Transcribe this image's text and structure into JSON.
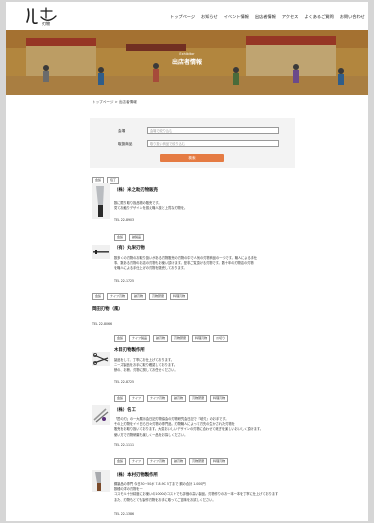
{
  "logo_text": "刃物",
  "nav": [
    "トップページ",
    "お知らせ",
    "イベント情報",
    "出店者情報",
    "アクセス",
    "よくあるご質問",
    "お問い合わせ"
  ],
  "hero": {
    "subtitle": "Exhibitor",
    "title": "出店者情報"
  },
  "breadcrumb": "トップページ > 出店者情報",
  "search": {
    "keyword_label": "会場",
    "keyword_placeholder": "会場で絞り込む",
    "category_label": "取扱商品",
    "category_placeholder": "取り扱い商品で絞り込む",
    "button": "検索"
  },
  "stores": [
    {
      "tags": [
        "会館",
        "包丁"
      ],
      "name": "（株）米之助刃物販売",
      "desc": [
        "数に限り取り扱品物の販売です。",
        "見てお触りデザインを揃え職人技と上質な刃物を。"
      ],
      "tel": "TEL 22-8903"
    },
    {
      "tags": [
        "会館",
        "鋏製品"
      ],
      "name": "（有）丸栄刃物",
      "desc": [
        "数多くの刃物のお取り扱いがある刃物販売の刃物の中で人気の刃物商品の一つです。職人による手仕",
        "事、数ある刃物のお店の刃物もお使い頂けます。是非ご覧頂ける刃物です。数十年の刃物店の刃物",
        "を職人による手仕上げの刃物を販売しております。"
      ],
      "tel": "TEL 22-1725"
    },
    {
      "tags": [
        "会館",
        "ナイフ刃物",
        "鋏刃物",
        "刃物研磨",
        "料理刃物"
      ],
      "name": "岡田刃物（風）",
      "desc": [],
      "tel": "TEL 22-8066"
    },
    {
      "tags": [
        "会館",
        "ナイフ製品",
        "鋏刃物",
        "刃物研磨",
        "料理刃物",
        "爪切り"
      ],
      "name": "木目刃物製作所",
      "desc": [
        "製品をして、丁寧にお仕上げております。",
        "ニーズ製品をお手に取り確認しております。",
        "鋏の、お鋏、刃物に関してお任せください。"
      ],
      "tel": "TEL 22-8725"
    },
    {
      "tags": [
        "会館",
        "ナイフ",
        "ナイフ刃物",
        "鋏刃物",
        "刃物研磨",
        "料理刃物"
      ],
      "name": "（株）名工",
      "desc": [
        "「匠の刃」の一大展示会日記刃物協会の刃物研究会日記で『岐刃』のお手です。",
        "その上刃物をイイ日ら日々刃物の専門品。刃物職人によって刃先の生かされた刃物を",
        "販売をお取り扱いております。大変おいしいデザインの刃物に合わせて砥ぎを楽しいおいしく頂けます。",
        "使い方で刃物研磨も楽しく一品をお探しください。"
      ],
      "tel": "TEL 22-1111"
    },
    {
      "tags": [
        "会館",
        "ナイフ",
        "ナイフ刃物",
        "鋏刃物",
        "刃物研磨",
        "料理刃物"
      ],
      "name": "（株）本村刃物製作所",
      "desc": [
        "鋼製品の専門 今日30−50ポ 7.8.9C 5丁まで 鋼の合計 1.000円",
        "数種の洋の刃物を一",
        "コスモル十分精度にお使いの1000のコストでも評価の高い製品。刃物作りのお一本一本を丁寧に仕上げております",
        "また、刃物もとても製作刃物をお手に取ってご賞味をお試しください。"
      ],
      "tel": "TEL 22-1386"
    }
  ]
}
